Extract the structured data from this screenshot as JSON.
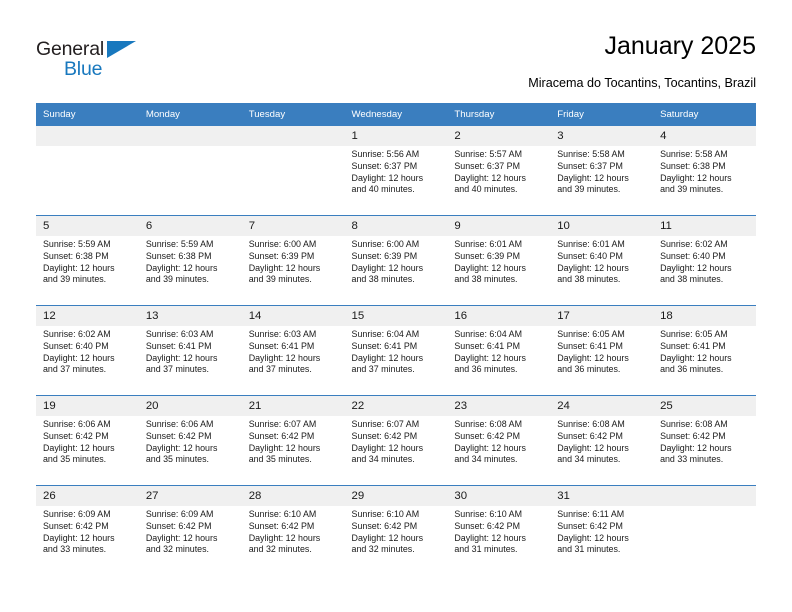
{
  "brand": {
    "name_top": "General",
    "name_bottom": "Blue",
    "triangle_icon": "triangle-icon",
    "color_dark": "#231f20",
    "color_blue": "#1878be"
  },
  "header": {
    "title": "January 2025",
    "subtitle": "Miracema do Tocantins, Tocantins, Brazil"
  },
  "calendar": {
    "accent_color": "#3a7ebf",
    "daynum_background": "#f0f0f0",
    "weekday_headers": [
      "Sunday",
      "Monday",
      "Tuesday",
      "Wednesday",
      "Thursday",
      "Friday",
      "Saturday"
    ],
    "weeks": [
      [
        {
          "day": "",
          "sunrise": "",
          "sunset": "",
          "daylight_line1": "",
          "daylight_line2": "",
          "empty": true
        },
        {
          "day": "",
          "sunrise": "",
          "sunset": "",
          "daylight_line1": "",
          "daylight_line2": "",
          "empty": true
        },
        {
          "day": "",
          "sunrise": "",
          "sunset": "",
          "daylight_line1": "",
          "daylight_line2": "",
          "empty": true
        },
        {
          "day": "1",
          "sunrise": "Sunrise: 5:56 AM",
          "sunset": "Sunset: 6:37 PM",
          "daylight_line1": "Daylight: 12 hours",
          "daylight_line2": "and 40 minutes.",
          "empty": false
        },
        {
          "day": "2",
          "sunrise": "Sunrise: 5:57 AM",
          "sunset": "Sunset: 6:37 PM",
          "daylight_line1": "Daylight: 12 hours",
          "daylight_line2": "and 40 minutes.",
          "empty": false
        },
        {
          "day": "3",
          "sunrise": "Sunrise: 5:58 AM",
          "sunset": "Sunset: 6:37 PM",
          "daylight_line1": "Daylight: 12 hours",
          "daylight_line2": "and 39 minutes.",
          "empty": false
        },
        {
          "day": "4",
          "sunrise": "Sunrise: 5:58 AM",
          "sunset": "Sunset: 6:38 PM",
          "daylight_line1": "Daylight: 12 hours",
          "daylight_line2": "and 39 minutes.",
          "empty": false
        }
      ],
      [
        {
          "day": "5",
          "sunrise": "Sunrise: 5:59 AM",
          "sunset": "Sunset: 6:38 PM",
          "daylight_line1": "Daylight: 12 hours",
          "daylight_line2": "and 39 minutes.",
          "empty": false
        },
        {
          "day": "6",
          "sunrise": "Sunrise: 5:59 AM",
          "sunset": "Sunset: 6:38 PM",
          "daylight_line1": "Daylight: 12 hours",
          "daylight_line2": "and 39 minutes.",
          "empty": false
        },
        {
          "day": "7",
          "sunrise": "Sunrise: 6:00 AM",
          "sunset": "Sunset: 6:39 PM",
          "daylight_line1": "Daylight: 12 hours",
          "daylight_line2": "and 39 minutes.",
          "empty": false
        },
        {
          "day": "8",
          "sunrise": "Sunrise: 6:00 AM",
          "sunset": "Sunset: 6:39 PM",
          "daylight_line1": "Daylight: 12 hours",
          "daylight_line2": "and 38 minutes.",
          "empty": false
        },
        {
          "day": "9",
          "sunrise": "Sunrise: 6:01 AM",
          "sunset": "Sunset: 6:39 PM",
          "daylight_line1": "Daylight: 12 hours",
          "daylight_line2": "and 38 minutes.",
          "empty": false
        },
        {
          "day": "10",
          "sunrise": "Sunrise: 6:01 AM",
          "sunset": "Sunset: 6:40 PM",
          "daylight_line1": "Daylight: 12 hours",
          "daylight_line2": "and 38 minutes.",
          "empty": false
        },
        {
          "day": "11",
          "sunrise": "Sunrise: 6:02 AM",
          "sunset": "Sunset: 6:40 PM",
          "daylight_line1": "Daylight: 12 hours",
          "daylight_line2": "and 38 minutes.",
          "empty": false
        }
      ],
      [
        {
          "day": "12",
          "sunrise": "Sunrise: 6:02 AM",
          "sunset": "Sunset: 6:40 PM",
          "daylight_line1": "Daylight: 12 hours",
          "daylight_line2": "and 37 minutes.",
          "empty": false
        },
        {
          "day": "13",
          "sunrise": "Sunrise: 6:03 AM",
          "sunset": "Sunset: 6:41 PM",
          "daylight_line1": "Daylight: 12 hours",
          "daylight_line2": "and 37 minutes.",
          "empty": false
        },
        {
          "day": "14",
          "sunrise": "Sunrise: 6:03 AM",
          "sunset": "Sunset: 6:41 PM",
          "daylight_line1": "Daylight: 12 hours",
          "daylight_line2": "and 37 minutes.",
          "empty": false
        },
        {
          "day": "15",
          "sunrise": "Sunrise: 6:04 AM",
          "sunset": "Sunset: 6:41 PM",
          "daylight_line1": "Daylight: 12 hours",
          "daylight_line2": "and 37 minutes.",
          "empty": false
        },
        {
          "day": "16",
          "sunrise": "Sunrise: 6:04 AM",
          "sunset": "Sunset: 6:41 PM",
          "daylight_line1": "Daylight: 12 hours",
          "daylight_line2": "and 36 minutes.",
          "empty": false
        },
        {
          "day": "17",
          "sunrise": "Sunrise: 6:05 AM",
          "sunset": "Sunset: 6:41 PM",
          "daylight_line1": "Daylight: 12 hours",
          "daylight_line2": "and 36 minutes.",
          "empty": false
        },
        {
          "day": "18",
          "sunrise": "Sunrise: 6:05 AM",
          "sunset": "Sunset: 6:41 PM",
          "daylight_line1": "Daylight: 12 hours",
          "daylight_line2": "and 36 minutes.",
          "empty": false
        }
      ],
      [
        {
          "day": "19",
          "sunrise": "Sunrise: 6:06 AM",
          "sunset": "Sunset: 6:42 PM",
          "daylight_line1": "Daylight: 12 hours",
          "daylight_line2": "and 35 minutes.",
          "empty": false
        },
        {
          "day": "20",
          "sunrise": "Sunrise: 6:06 AM",
          "sunset": "Sunset: 6:42 PM",
          "daylight_line1": "Daylight: 12 hours",
          "daylight_line2": "and 35 minutes.",
          "empty": false
        },
        {
          "day": "21",
          "sunrise": "Sunrise: 6:07 AM",
          "sunset": "Sunset: 6:42 PM",
          "daylight_line1": "Daylight: 12 hours",
          "daylight_line2": "and 35 minutes.",
          "empty": false
        },
        {
          "day": "22",
          "sunrise": "Sunrise: 6:07 AM",
          "sunset": "Sunset: 6:42 PM",
          "daylight_line1": "Daylight: 12 hours",
          "daylight_line2": "and 34 minutes.",
          "empty": false
        },
        {
          "day": "23",
          "sunrise": "Sunrise: 6:08 AM",
          "sunset": "Sunset: 6:42 PM",
          "daylight_line1": "Daylight: 12 hours",
          "daylight_line2": "and 34 minutes.",
          "empty": false
        },
        {
          "day": "24",
          "sunrise": "Sunrise: 6:08 AM",
          "sunset": "Sunset: 6:42 PM",
          "daylight_line1": "Daylight: 12 hours",
          "daylight_line2": "and 34 minutes.",
          "empty": false
        },
        {
          "day": "25",
          "sunrise": "Sunrise: 6:08 AM",
          "sunset": "Sunset: 6:42 PM",
          "daylight_line1": "Daylight: 12 hours",
          "daylight_line2": "and 33 minutes.",
          "empty": false
        }
      ],
      [
        {
          "day": "26",
          "sunrise": "Sunrise: 6:09 AM",
          "sunset": "Sunset: 6:42 PM",
          "daylight_line1": "Daylight: 12 hours",
          "daylight_line2": "and 33 minutes.",
          "empty": false
        },
        {
          "day": "27",
          "sunrise": "Sunrise: 6:09 AM",
          "sunset": "Sunset: 6:42 PM",
          "daylight_line1": "Daylight: 12 hours",
          "daylight_line2": "and 32 minutes.",
          "empty": false
        },
        {
          "day": "28",
          "sunrise": "Sunrise: 6:10 AM",
          "sunset": "Sunset: 6:42 PM",
          "daylight_line1": "Daylight: 12 hours",
          "daylight_line2": "and 32 minutes.",
          "empty": false
        },
        {
          "day": "29",
          "sunrise": "Sunrise: 6:10 AM",
          "sunset": "Sunset: 6:42 PM",
          "daylight_line1": "Daylight: 12 hours",
          "daylight_line2": "and 32 minutes.",
          "empty": false
        },
        {
          "day": "30",
          "sunrise": "Sunrise: 6:10 AM",
          "sunset": "Sunset: 6:42 PM",
          "daylight_line1": "Daylight: 12 hours",
          "daylight_line2": "and 31 minutes.",
          "empty": false
        },
        {
          "day": "31",
          "sunrise": "Sunrise: 6:11 AM",
          "sunset": "Sunset: 6:42 PM",
          "daylight_line1": "Daylight: 12 hours",
          "daylight_line2": "and 31 minutes.",
          "empty": false
        },
        {
          "day": "",
          "sunrise": "",
          "sunset": "",
          "daylight_line1": "",
          "daylight_line2": "",
          "empty": true
        }
      ]
    ]
  }
}
